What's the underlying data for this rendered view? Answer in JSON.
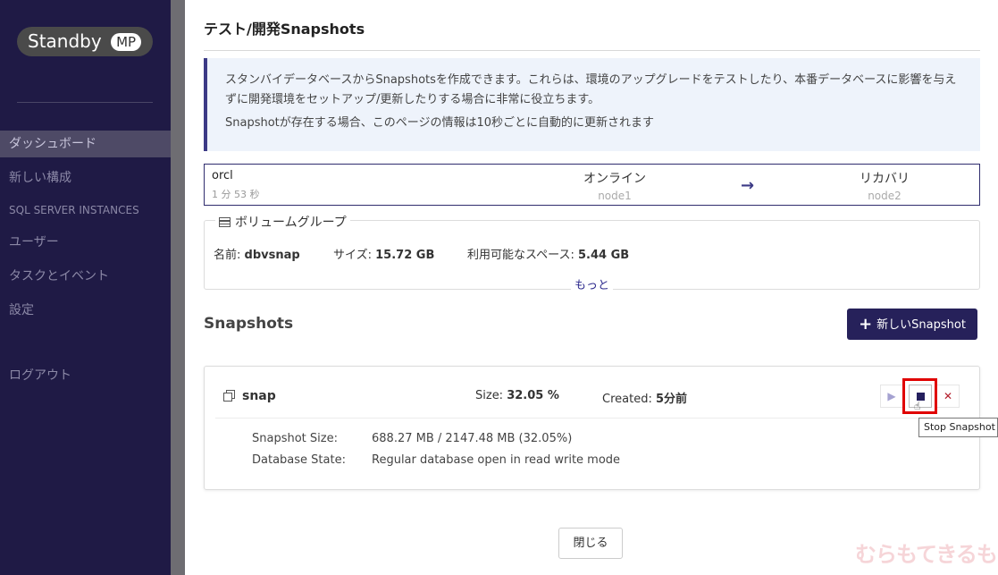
{
  "sidebar": {
    "logo_text": "Standby",
    "logo_badge": "MP",
    "items": [
      {
        "label": "ダッシュボード",
        "active": true
      },
      {
        "label": "新しい構成"
      },
      {
        "label": "SQL SERVER INSTANCES"
      },
      {
        "label": "ユーザー"
      },
      {
        "label": "タスクとイベント"
      },
      {
        "label": "設定"
      },
      {
        "label": "ログアウト"
      }
    ]
  },
  "modal": {
    "title": "テスト/開発Snapshots",
    "info_line1": "スタンバイデータベースからSnapshotsを作成できます。これらは、環境のアップグレードをテストしたり、本番データベースに影響を与えずに開発環境をセットアップ/更新したりする場合に非常に役立ちます。",
    "info_line2": "Snapshotが存在する場合、このページの情報は10秒ごとに自動的に更新されます",
    "status": {
      "db_name": "orcl",
      "duration": "1 分 53 秒",
      "primary_state": "オンライン",
      "primary_node": "node1",
      "standby_state": "リカバリ",
      "standby_node": "node2",
      "arrow": "→"
    },
    "volume_group": {
      "legend": "ボリュームグループ",
      "name_label": "名前:",
      "name_value": "dbvsnap",
      "size_label": "サイズ:",
      "size_value": "15.72 GB",
      "free_label": "利用可能なスペース:",
      "free_value": "5.44 GB",
      "more": "もっと"
    },
    "snapshots_heading": "Snapshots",
    "new_snapshot_label": "新しいSnapshot",
    "snapshot": {
      "name": "snap",
      "size_label": "Size:",
      "size_value": "32.05 %",
      "created_label": "Created:",
      "created_value": "5分前",
      "details": [
        {
          "key": "Snapshot Size:",
          "value": "688.27 MB / 2147.48 MB (32.05%)"
        },
        {
          "key": "Database State:",
          "value": "Regular database open in read write mode"
        }
      ]
    },
    "tooltip": "Stop Snapshot D",
    "close_label": "閉じる"
  },
  "watermark": "むらもてきるもん",
  "colors": {
    "sidebar_bg": "#1f1a45",
    "accent": "#26215a",
    "highlight": "#e00000",
    "delete": "#b31c2a"
  }
}
